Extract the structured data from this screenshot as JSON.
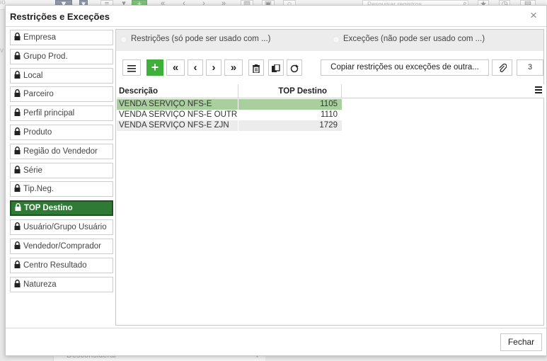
{
  "background": {
    "search_placeholder": "Pesquisar registros",
    "bottom_select_value": "Desconsiderar"
  },
  "modal": {
    "title": "Restrições e Exceções",
    "close_glyph": "×",
    "close_label": "Fechar"
  },
  "sidebar": {
    "items": [
      {
        "label": "Empresa",
        "active": false
      },
      {
        "label": "Grupo Prod.",
        "active": false
      },
      {
        "label": "Local",
        "active": false
      },
      {
        "label": "Parceiro",
        "active": false
      },
      {
        "label": "Perfil principal",
        "active": false
      },
      {
        "label": "Produto",
        "active": false
      },
      {
        "label": "Região do Vendedor",
        "active": false
      },
      {
        "label": "Série",
        "active": false
      },
      {
        "label": "Tip.Neg.",
        "active": false
      },
      {
        "label": "TOP Destino",
        "active": true
      },
      {
        "label": "Usuário/Grupo Usuário",
        "active": false
      },
      {
        "label": "Vendedor/Comprador",
        "active": false
      },
      {
        "label": "Centro Resultado",
        "active": false
      },
      {
        "label": "Natureza",
        "active": false
      }
    ]
  },
  "mode": {
    "restricoes_label": "Restrições (só pode ser usado com ...)",
    "excecoes_label": "Exceções (não pode ser usado com ...)"
  },
  "toolbar": {
    "copy_label": "Copiar restrições ou exceções de outra...",
    "record_count": "3"
  },
  "grid": {
    "columns": [
      "Descrição",
      "TOP Destino"
    ],
    "rows": [
      {
        "descricao": "VENDA SERVIÇO NFS-E",
        "top_destino": "1105",
        "selected": true
      },
      {
        "descricao": "VENDA SERVIÇO NFS-E OUTROS",
        "top_destino": "1110",
        "selected": false
      },
      {
        "descricao": "VENDA SERVIÇO NFS-E ZJN",
        "top_destino": "1729",
        "selected": false
      }
    ]
  },
  "colors": {
    "active_item_bg": "#2f7a34",
    "add_button": "#3fae3b",
    "selected_row": "#a9cf9f"
  }
}
